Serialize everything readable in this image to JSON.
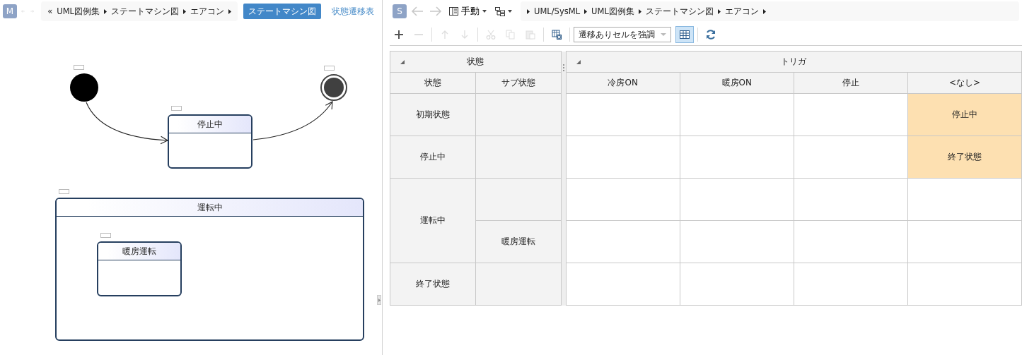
{
  "left_pane": {
    "avatar": "M",
    "breadcrumb_back": "«",
    "breadcrumb": [
      "UML図例集",
      "ステートマシン図",
      "エアコン"
    ],
    "tabs": [
      {
        "label": "ステートマシン図",
        "selected": true
      },
      {
        "label": "状態遷移表",
        "selected": false
      }
    ]
  },
  "diagram": {
    "nodes": [
      {
        "kind": "initial"
      },
      {
        "kind": "final"
      },
      {
        "kind": "state",
        "name": "停止中"
      },
      {
        "kind": "composite",
        "name": "運転中"
      },
      {
        "kind": "state",
        "name": "暖房運転"
      }
    ]
  },
  "right_pane": {
    "avatar": "S",
    "layout_mode": "手動",
    "breadcrumb": [
      "UML/SysML",
      "UML図例集",
      "ステートマシン図",
      "エアコン"
    ],
    "tool_buttons": [
      {
        "kind": "add",
        "disabled": false
      },
      {
        "kind": "remove",
        "disabled": true
      },
      {
        "kind": "up",
        "disabled": true
      },
      {
        "kind": "down",
        "disabled": true
      },
      {
        "kind": "cut",
        "disabled": true
      },
      {
        "kind": "copy",
        "disabled": true
      },
      {
        "kind": "paste",
        "disabled": true
      },
      {
        "kind": "export",
        "disabled": false
      }
    ],
    "filter": {
      "value": "遷移ありセルを強調"
    },
    "grid_toggle": {
      "on": true
    }
  },
  "table": {
    "group_headers": [
      "状態",
      "トリガ"
    ],
    "columns": [
      "状態",
      "サブ状態"
    ],
    "triggers": [
      "冷房ON",
      "暖房ON",
      "停止",
      "<なし>"
    ],
    "states": [
      {
        "name": "初期状態",
        "rows": [
          {
            "cells": [
              {
                "highlighted": false
              },
              {
                "highlighted": false
              },
              {
                "highlighted": false
              },
              {
                "text": "停止中",
                "highlighted": true
              }
            ]
          }
        ]
      },
      {
        "name": "停止中",
        "rows": [
          {
            "cells": [
              {
                "highlighted": false
              },
              {
                "highlighted": false
              },
              {
                "highlighted": false
              },
              {
                "text": "終了状態",
                "highlighted": true
              }
            ]
          }
        ]
      },
      {
        "name": "運転中",
        "rows": [
          {
            "cells": [
              {
                "highlighted": false
              },
              {
                "highlighted": false
              },
              {
                "highlighted": false
              },
              {
                "highlighted": false
              }
            ]
          },
          {
            "substate": "暖房運転",
            "cells": [
              {
                "highlighted": false
              },
              {
                "highlighted": false
              },
              {
                "highlighted": false
              },
              {
                "highlighted": false
              }
            ]
          }
        ]
      },
      {
        "name": "終了状態",
        "rows": [
          {
            "cells": [
              {
                "highlighted": false
              },
              {
                "highlighted": false
              },
              {
                "highlighted": false
              },
              {
                "highlighted": false
              }
            ]
          }
        ]
      }
    ]
  }
}
